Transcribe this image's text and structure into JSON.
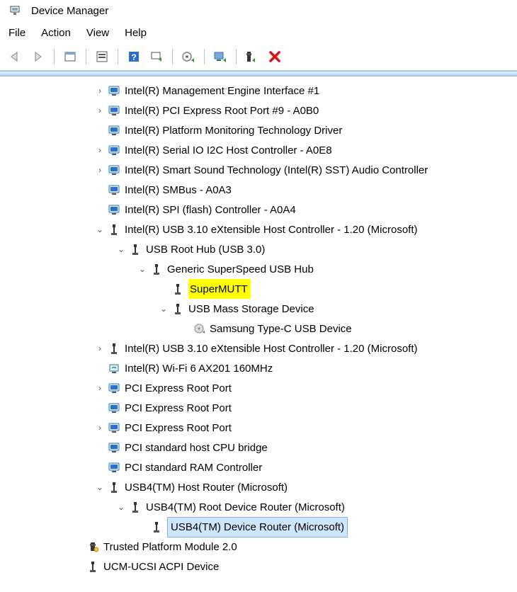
{
  "window": {
    "title": "Device Manager"
  },
  "menu": {
    "file": "File",
    "action": "Action",
    "view": "View",
    "help": "Help"
  },
  "tree": {
    "n0": "Intel(R) Management Engine Interface #1",
    "n1": "Intel(R) PCI Express Root Port #9 - A0B0",
    "n2": "Intel(R) Platform Monitoring Technology Driver",
    "n3": "Intel(R) Serial IO I2C Host Controller - A0E8",
    "n4": "Intel(R) Smart Sound Technology (Intel(R) SST) Audio Controller",
    "n5": "Intel(R) SMBus - A0A3",
    "n6": "Intel(R) SPI (flash) Controller - A0A4",
    "n7": "Intel(R) USB 3.10 eXtensible Host Controller - 1.20 (Microsoft)",
    "n8": "USB Root Hub (USB 3.0)",
    "n9": "Generic SuperSpeed USB Hub",
    "n10": "SuperMUTT",
    "n11": "USB Mass Storage Device",
    "n12": "Samsung Type-C USB Device",
    "n13": "Intel(R) USB 3.10 eXtensible Host Controller - 1.20 (Microsoft)",
    "n14": "Intel(R) Wi-Fi 6 AX201 160MHz",
    "n15": "PCI Express Root Port",
    "n16": "PCI Express Root Port",
    "n17": "PCI Express Root Port",
    "n18": "PCI standard host CPU bridge",
    "n19": "PCI standard RAM Controller",
    "n20": "USB4(TM) Host Router (Microsoft)",
    "n21": "USB4(TM) Root Device Router (Microsoft)",
    "n22": "USB4(TM) Device Router (Microsoft)",
    "n23": "Trusted Platform Module 2.0",
    "n24": "UCM-UCSI ACPI Device"
  }
}
